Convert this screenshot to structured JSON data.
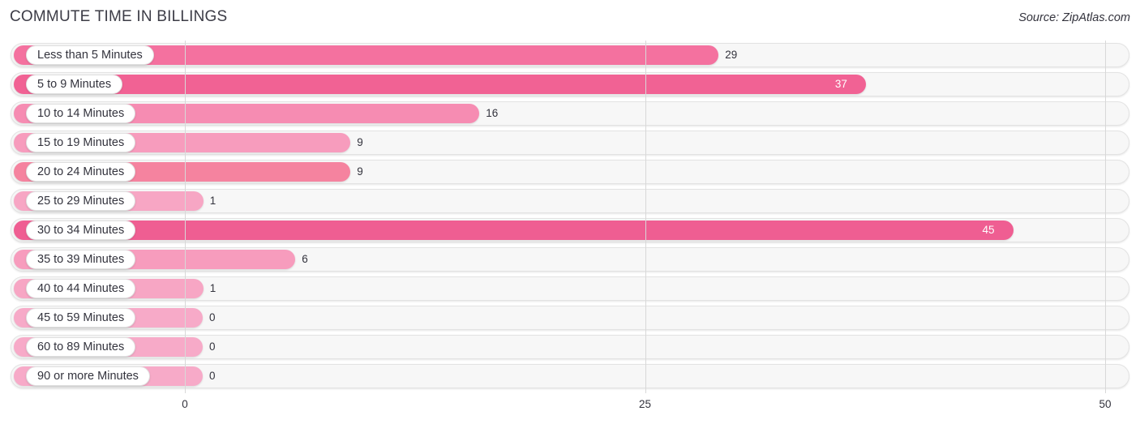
{
  "header": {
    "title": "COMMUTE TIME IN BILLINGS",
    "source": "Source: ZipAtlas.com"
  },
  "colors": {
    "bar_max": "#ef5e92",
    "bar_high": "#f4719f",
    "bar_mid": "#f583ab",
    "bar_low": "#f79cbd",
    "bar_min": "#f7aac8",
    "track": "#f7f7f7",
    "gridline": "#d8d8d8",
    "text": "#33333d"
  },
  "chart_data": {
    "type": "bar",
    "orientation": "horizontal",
    "title": "COMMUTE TIME IN BILLINGS",
    "xlabel": "",
    "ylabel": "",
    "xlim": [
      0,
      50
    ],
    "grid": true,
    "legend": "none",
    "xticks": [
      "0",
      "25",
      "50"
    ],
    "xtick_values": [
      0,
      25,
      50
    ],
    "categories": [
      "Less than 5 Minutes",
      "5 to 9 Minutes",
      "10 to 14 Minutes",
      "15 to 19 Minutes",
      "20 to 24 Minutes",
      "25 to 29 Minutes",
      "30 to 34 Minutes",
      "35 to 39 Minutes",
      "40 to 44 Minutes",
      "45 to 59 Minutes",
      "60 to 89 Minutes",
      "90 or more Minutes"
    ],
    "values": [
      29,
      37,
      16,
      9,
      9,
      1,
      45,
      6,
      1,
      0,
      0,
      0
    ],
    "value_labels": [
      "29",
      "37",
      "16",
      "9",
      "9",
      "1",
      "45",
      "6",
      "1",
      "0",
      "0",
      "0"
    ]
  },
  "rows": [
    {
      "label": "Less than 5 Minutes",
      "value": 29,
      "value_label": "29",
      "color": "#f4719f",
      "inside": false
    },
    {
      "label": "5 to 9 Minutes",
      "value": 37,
      "value_label": "37",
      "color": "#f16294",
      "inside": true
    },
    {
      "label": "10 to 14 Minutes",
      "value": 16,
      "value_label": "16",
      "color": "#f68cb2",
      "inside": false
    },
    {
      "label": "15 to 19 Minutes",
      "value": 9,
      "value_label": "9",
      "color": "#f79cbd",
      "inside": false
    },
    {
      "label": "20 to 24 Minutes",
      "value": 9,
      "value_label": "9",
      "color": "#f5839f",
      "inside": false
    },
    {
      "label": "25 to 29 Minutes",
      "value": 1,
      "value_label": "1",
      "color": "#f7a6c4",
      "inside": false
    },
    {
      "label": "30 to 34 Minutes",
      "value": 45,
      "value_label": "45",
      "color": "#ef5e92",
      "inside": true
    },
    {
      "label": "35 to 39 Minutes",
      "value": 6,
      "value_label": "6",
      "color": "#f79cbd",
      "inside": false
    },
    {
      "label": "40 to 44 Minutes",
      "value": 1,
      "value_label": "1",
      "color": "#f7a6c4",
      "inside": false
    },
    {
      "label": "45 to 59 Minutes",
      "value": 0,
      "value_label": "0",
      "color": "#f7aac8",
      "inside": false
    },
    {
      "label": "60 to 89 Minutes",
      "value": 0,
      "value_label": "0",
      "color": "#f7aac8",
      "inside": false
    },
    {
      "label": "90 or more Minutes",
      "value": 0,
      "value_label": "0",
      "color": "#f7aac8",
      "inside": false
    }
  ],
  "axis": {
    "ticks": [
      {
        "label": "0",
        "value": 0
      },
      {
        "label": "25",
        "value": 25
      },
      {
        "label": "50",
        "value": 50
      }
    ]
  }
}
